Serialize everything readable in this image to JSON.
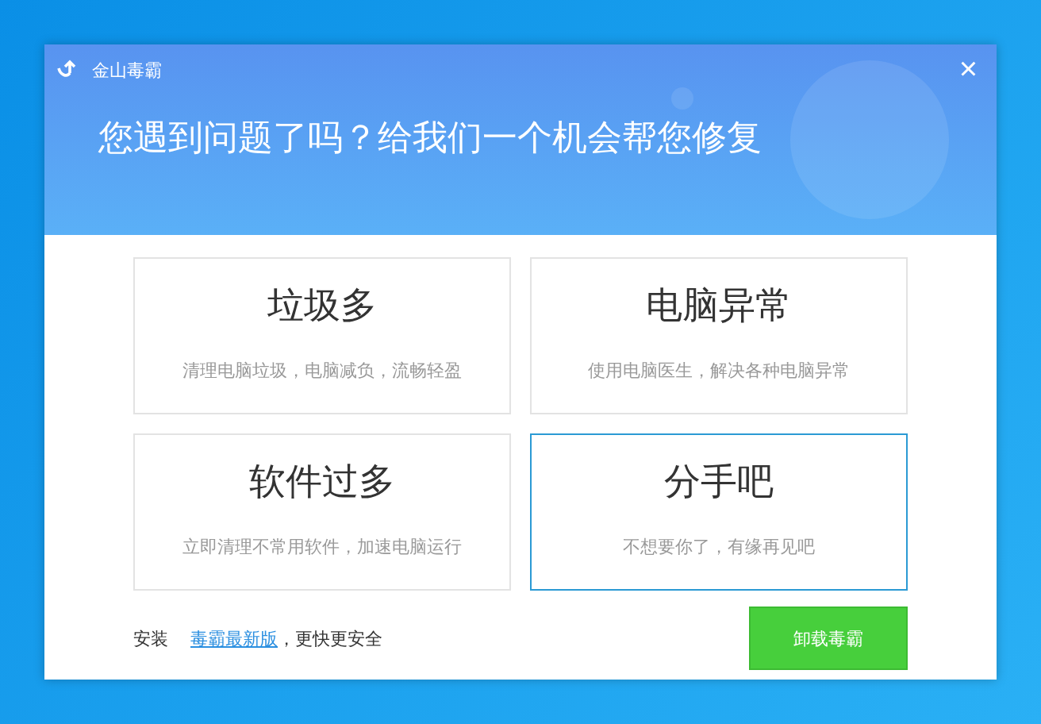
{
  "window": {
    "title": "金山毒霸",
    "close": "×"
  },
  "headline": "您遇到问题了吗？给我们一个机会帮您修复",
  "options": [
    {
      "title": "垃圾多",
      "description": "清理电脑垃圾，电脑减负，流畅轻盈",
      "selected": false
    },
    {
      "title": "电脑异常",
      "description": "使用电脑医生，解决各种电脑异常",
      "selected": false
    },
    {
      "title": "软件过多",
      "description": "立即清理不常用软件，加速电脑运行",
      "selected": false
    },
    {
      "title": "分手吧",
      "description": "不想要你了，有缘再见吧",
      "selected": true
    }
  ],
  "footer": {
    "prefix": "安装",
    "link": "毒霸最新版",
    "suffix": "，更快更安全",
    "button": "卸载毒霸"
  }
}
